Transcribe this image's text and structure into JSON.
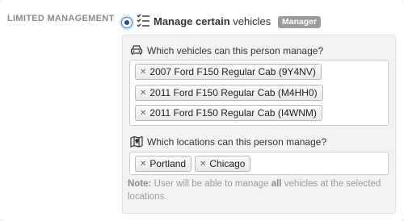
{
  "section": {
    "label": "LIMITED MANAGEMENT"
  },
  "option": {
    "strong": "Manage certain",
    "rest": " vehicles",
    "badge": "Manager"
  },
  "vehicles": {
    "question": "Which vehicles can this person manage?",
    "tags": [
      "2007 Ford F150 Regular Cab (9Y4NV)",
      "2011 Ford F150 Regular Cab (M4HH0)",
      "2011 Ford F150 Regular Cab (I4WNM)"
    ]
  },
  "locations": {
    "question": "Which locations can this person manage?",
    "tags": [
      "Portland",
      "Chicago"
    ]
  },
  "note": {
    "prefix": "Note:",
    "text1": " User will be able to manage ",
    "emph": "all",
    "text2": " vehicles at the selected locations."
  },
  "icons": {
    "radio": "radio-selected-icon",
    "list": "checklist-icon",
    "car": "car-icon",
    "map": "map-pin-icon",
    "remove": "remove-x-icon"
  }
}
